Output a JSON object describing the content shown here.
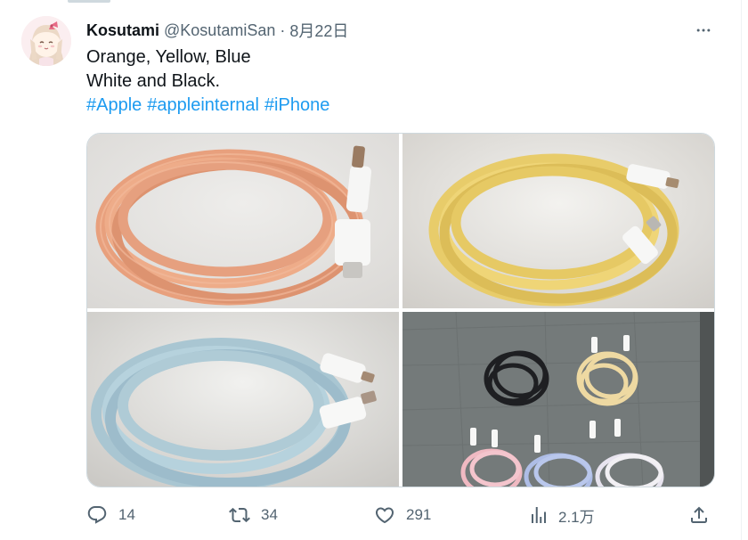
{
  "tweet": {
    "author_name": "Kosutami",
    "author_handle": "@KosutamiSan",
    "separator": "·",
    "date": "8月22日",
    "text_lines": [
      "Orange, Yellow, Blue",
      "White and Black."
    ],
    "hashtags": [
      "#Apple",
      "#appleinternal",
      "#iPhone"
    ],
    "media": [
      {
        "subject": "orange braided USB-C cable coiled on white surface"
      },
      {
        "subject": "yellow braided USB-C cable coiled on white surface"
      },
      {
        "subject": "light blue braided USB-C cable coiled on white surface"
      },
      {
        "subject": "black, yellow, pink, blue and white cables laid on grey tarp"
      }
    ]
  },
  "actions": {
    "reply_count": "14",
    "retweet_count": "34",
    "like_count": "291",
    "views_count": "2.1万"
  },
  "icons": {
    "more": "more-dots-icon",
    "reply": "reply-icon",
    "retweet": "retweet-icon",
    "like": "heart-icon",
    "views": "views-chart-icon",
    "share": "share-icon"
  },
  "colors": {
    "link": "#1d9bf0",
    "secondary_text": "#536471",
    "primary_text": "#0f1419"
  }
}
